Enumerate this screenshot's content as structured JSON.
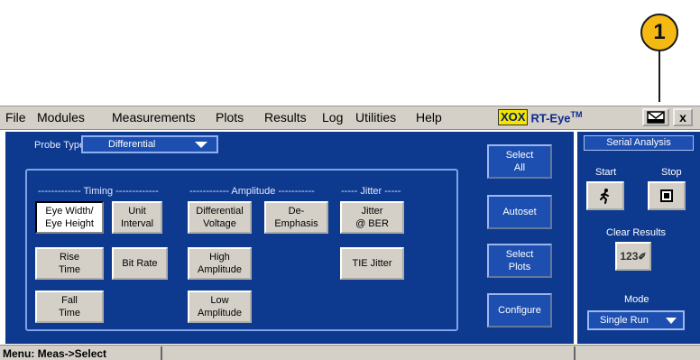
{
  "callout": {
    "number": "1"
  },
  "menubar": {
    "items": [
      "File",
      "Modules",
      "Measurements",
      "Plots",
      "Results",
      "Log",
      "Utilities",
      "Help"
    ],
    "app_logo": "XOX",
    "app_name": "RT-Eye",
    "app_tm": "TM",
    "close_label": "x"
  },
  "probe": {
    "label": "Probe Type",
    "value": "Differential"
  },
  "sections": {
    "timing": "------------- Timing -------------",
    "amplitude": "------------ Amplitude -----------",
    "jitter": "----- Jitter -----"
  },
  "measurements": {
    "eye_width": [
      "Eye Width/",
      "Eye Height"
    ],
    "unit_interval": [
      "Unit",
      "Interval"
    ],
    "diff_voltage": [
      "Differential",
      "Voltage"
    ],
    "de_emphasis": [
      "De-",
      "Emphasis"
    ],
    "jitter_ber": [
      "Jitter",
      "@ BER"
    ],
    "rise_time": [
      "Rise",
      "Time"
    ],
    "bit_rate": "Bit Rate",
    "high_amp": [
      "High",
      "Amplitude"
    ],
    "tie_jitter": "TIE Jitter",
    "fall_time": [
      "Fall",
      "Time"
    ],
    "low_amp": [
      "Low",
      "Amplitude"
    ]
  },
  "actions": {
    "select_all": [
      "Select",
      "All"
    ],
    "autoset": "Autoset",
    "select_plots": [
      "Select",
      "Plots"
    ],
    "configure": "Configure"
  },
  "serial": {
    "header": "Serial Analysis",
    "start": "Start",
    "stop": "Stop",
    "clear_results": "Clear Results",
    "clear_icon_text": "123",
    "mode_label": "Mode",
    "mode_value": "Single Run"
  },
  "status": {
    "text": "Menu: Meas->Select"
  }
}
